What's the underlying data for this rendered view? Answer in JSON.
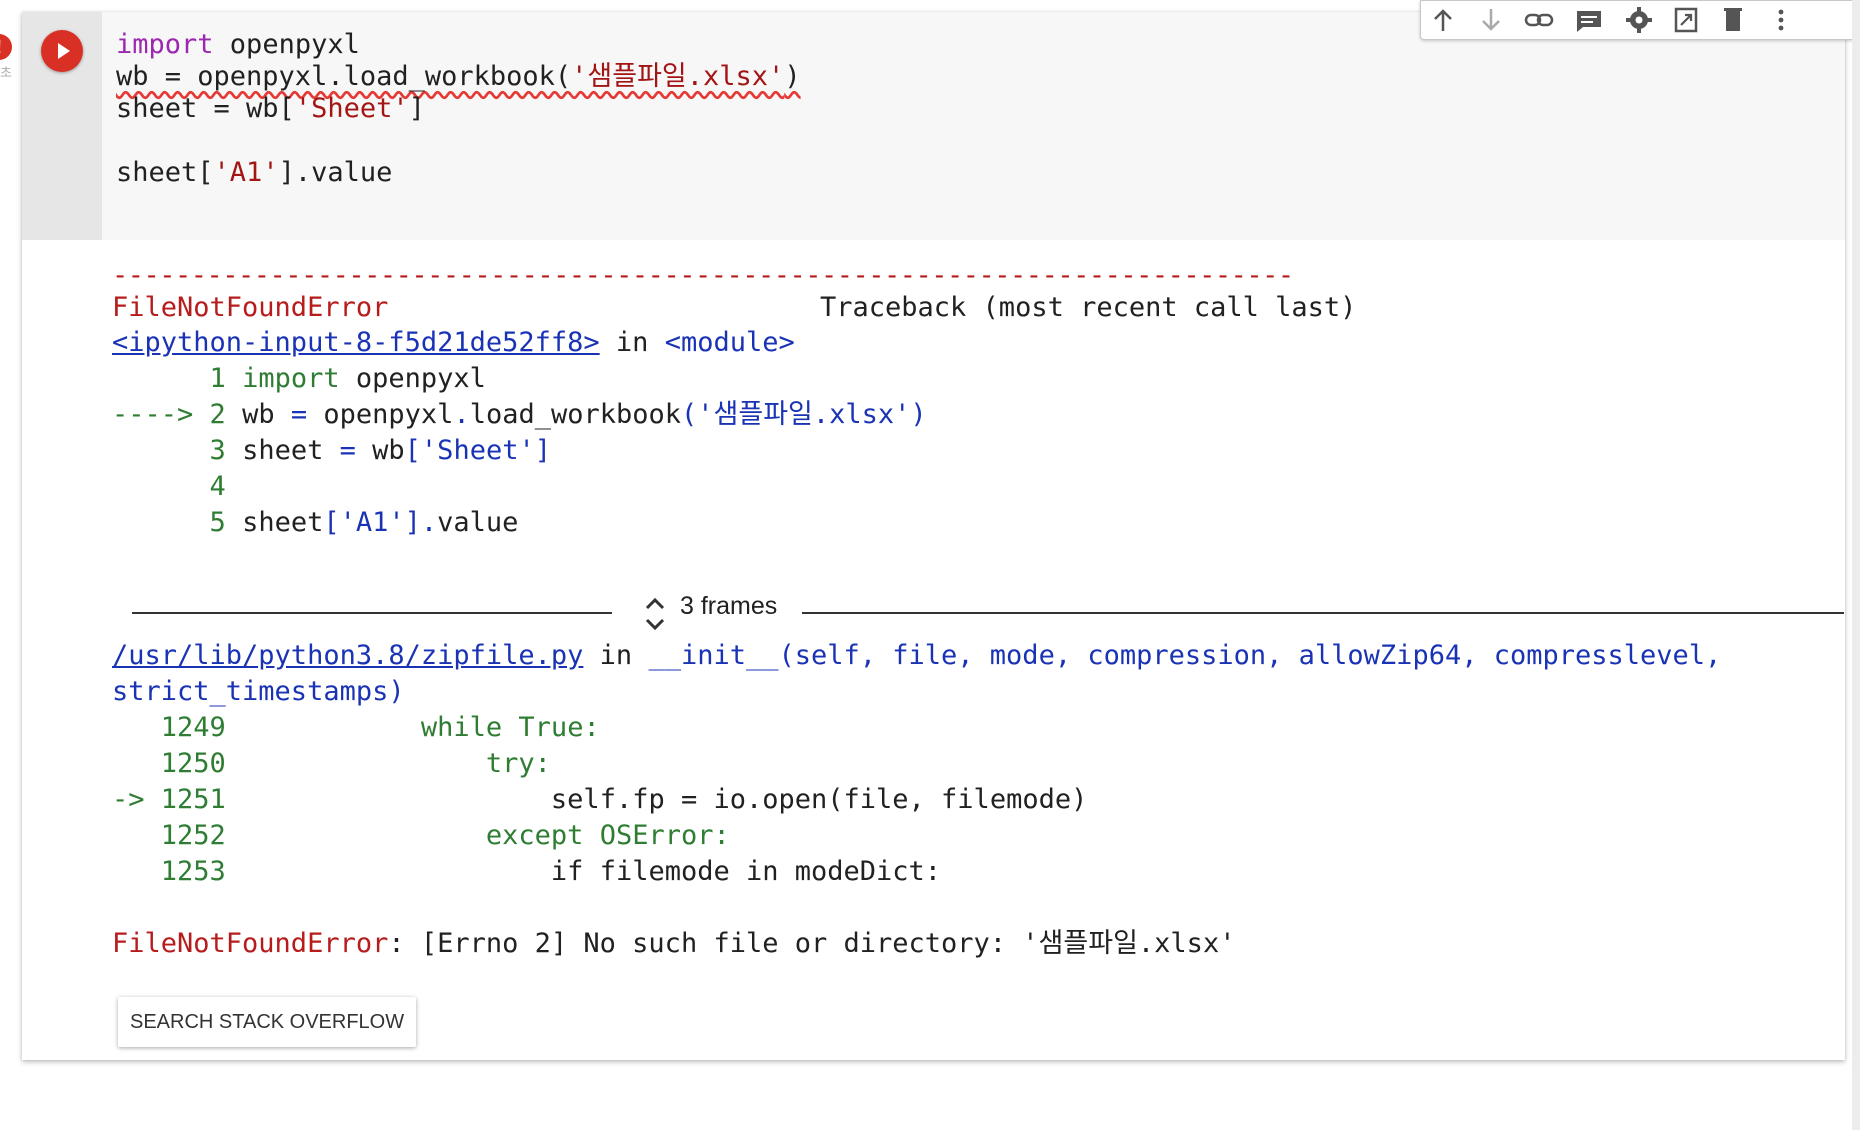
{
  "status": {
    "error_badge": "!",
    "error_sub": "초"
  },
  "toolbar": {
    "icons": [
      "move-up-icon",
      "move-down-icon",
      "link-icon",
      "comment-icon",
      "settings-icon",
      "mirror-cell-icon",
      "delete-icon",
      "more-options-icon"
    ]
  },
  "code": {
    "line1_kw": "import",
    "line1_rest": " openpyxl",
    "line2_pre": "wb = openpyxl.load_workbook(",
    "line2_str": "'샘플파일.xlsx'",
    "line2_post": ")",
    "line3_pre": "sheet = wb[",
    "line3_str": "'Sheet'",
    "line3_post": "]",
    "line5_pre": "sheet[",
    "line5_str": "'A1'",
    "line5_post": "].value"
  },
  "output": {
    "dashes": "---------------------------------------------------------------------------",
    "error_type": "FileNotFoundError",
    "traceback_header": "Traceback (most recent call last)",
    "frame1": {
      "link": "<ipython-input-8-f5d21de52ff8>",
      "in": " in ",
      "func": "<module>",
      "lines": [
        {
          "prefix": "      ",
          "num": "1",
          "text": "import openpyxl"
        },
        {
          "prefix": "----> ",
          "num": "2",
          "text": "wb = openpyxl.load_workbook('샘플파일.xlsx')"
        },
        {
          "prefix": "      ",
          "num": "3",
          "text": "sheet = wb['Sheet']"
        },
        {
          "prefix": "      ",
          "num": "4",
          "text": ""
        },
        {
          "prefix": "      ",
          "num": "5",
          "text": "sheet['A1'].value"
        }
      ]
    },
    "frames_label": "3 frames",
    "frame2": {
      "link": "/usr/lib/python3.8/zipfile.py",
      "in": " in ",
      "signature_line1": "__init__(self, file, mode, compression, allowZip64, compresslevel,",
      "signature_line2": "strict_timestamps)",
      "lines": [
        {
          "prefix": "   ",
          "num": "1249",
          "indent": "            ",
          "text": "while True:"
        },
        {
          "prefix": "   ",
          "num": "1250",
          "indent": "                ",
          "text": "try:"
        },
        {
          "prefix": "-> ",
          "num": "1251",
          "indent": "                    ",
          "text": "self.fp = io.open(file, filemode)"
        },
        {
          "prefix": "   ",
          "num": "1252",
          "indent": "                ",
          "text": "except OSError:"
        },
        {
          "prefix": "   ",
          "num": "1253",
          "indent": "                    ",
          "text": "if filemode in modeDict:"
        }
      ]
    },
    "final_error_type": "FileNotFoundError",
    "final_error_msg": ": [Errno 2] No such file or directory: '샘플파일.xlsx'"
  },
  "search_button": "SEARCH STACK OVERFLOW",
  "colors": {
    "run_button": "#d93025",
    "error_red": "#b71c1c",
    "link_blue": "#1a33b5",
    "keyword_purple": "#9c27b0"
  }
}
